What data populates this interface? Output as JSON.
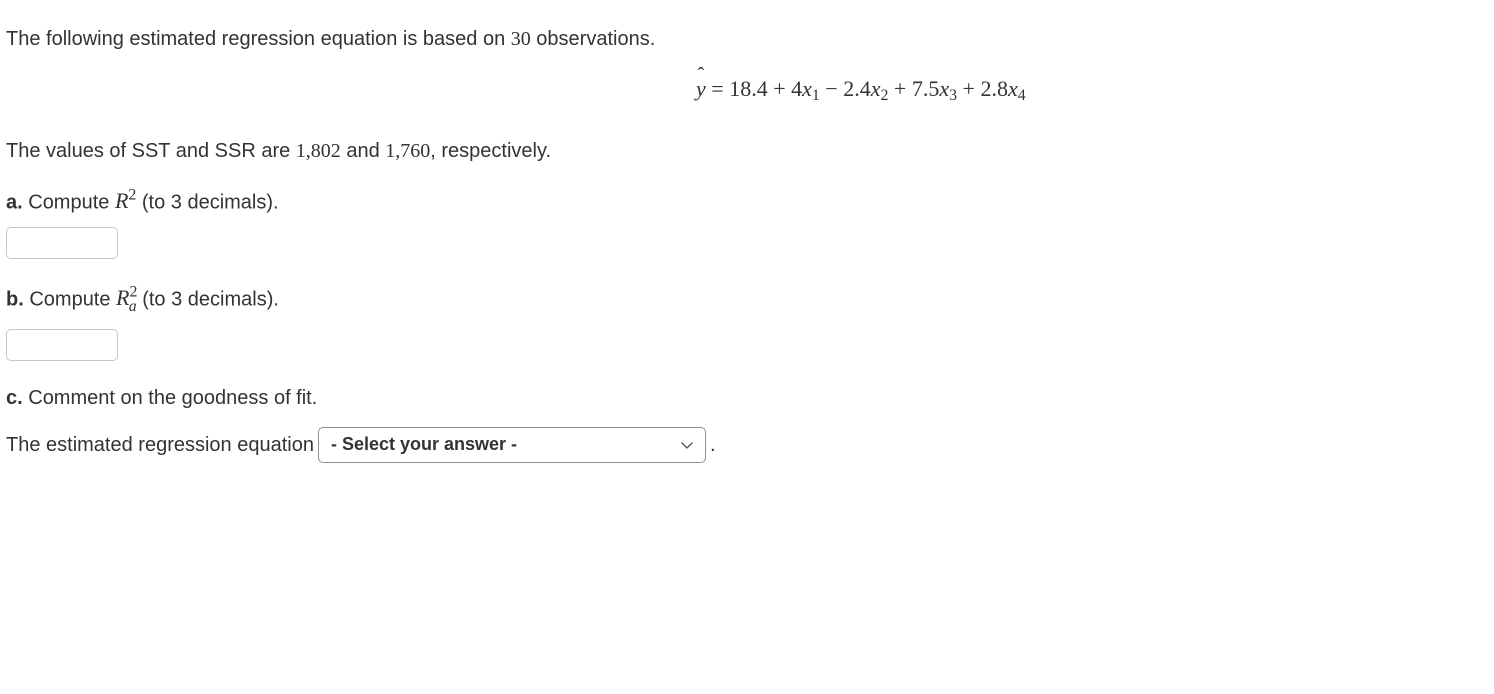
{
  "intro": {
    "pre": "The following estimated regression equation is based on ",
    "n": "30",
    "post": " observations."
  },
  "equation": {
    "yhat": "y",
    "eq": " = ",
    "c0": "18.4",
    "plus1": " + ",
    "b1": "4",
    "x1": "x",
    "s1": "1",
    "minus": " − ",
    "b2": "2.4",
    "x2": "x",
    "s2": "2",
    "plus3": " + ",
    "b3": "7.5",
    "x3": "x",
    "s3": "3",
    "plus4": " + ",
    "b4": "2.8",
    "x4": "x",
    "s4": "4"
  },
  "sst_line": {
    "pre": "The values of SST and SSR are ",
    "sst": "1,802",
    "mid": " and ",
    "ssr": "1,760",
    "post": ", respectively."
  },
  "qa": {
    "label": "a.",
    "text_pre": " Compute ",
    "R": "R",
    "sup": "2",
    "text_post": " (to 3 decimals)."
  },
  "qb": {
    "label": "b.",
    "text_pre": " Compute ",
    "R": "R",
    "sub": "a",
    "sup": "2",
    "text_post": " (to 3 decimals)."
  },
  "qc": {
    "label": "c.",
    "text": " Comment on the goodness of fit."
  },
  "answer_c": {
    "pre": "The estimated regression equation ",
    "select_placeholder": "- Select your answer -",
    "post": " ."
  }
}
